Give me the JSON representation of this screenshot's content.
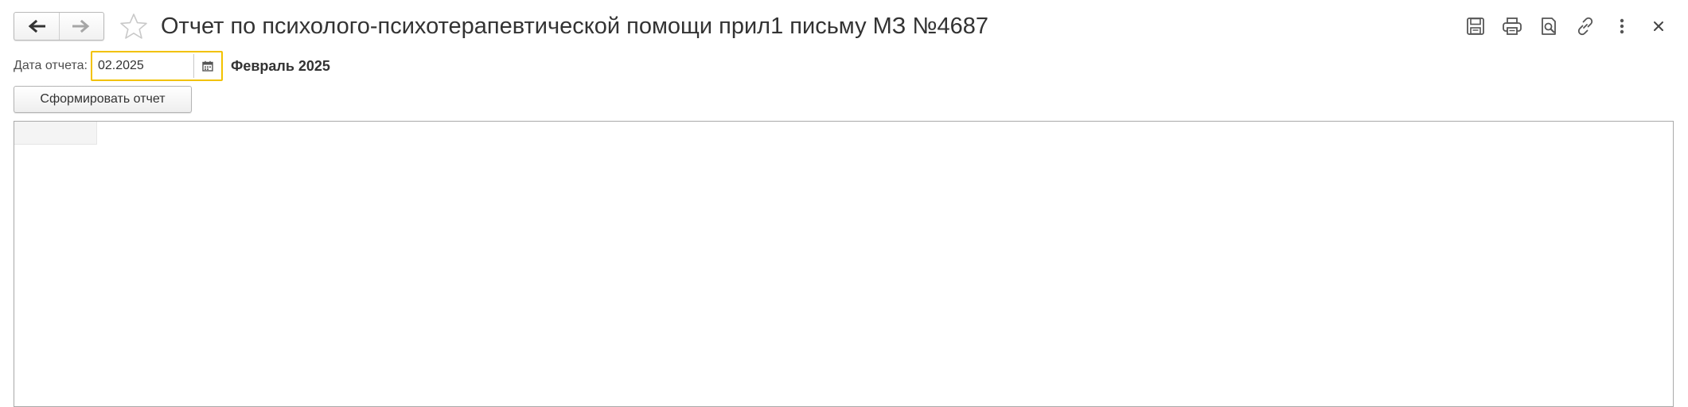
{
  "window": {
    "title": "Отчет по психолого-психотерапевтической помощи прил1 письму МЗ №4687"
  },
  "icons": {
    "back": "arrow-left-icon",
    "forward": "arrow-right-icon",
    "favorite": "star-icon",
    "save": "floppy-disk-icon",
    "print": "printer-icon",
    "preview": "page-preview-icon",
    "link": "link-icon",
    "more": "vertical-dots-icon",
    "close": "close-icon",
    "calendar": "calendar-icon"
  },
  "form": {
    "date_label": "Дата отчета:",
    "date_value": "02.2025",
    "period_text": "Февраль 2025",
    "generate_button": "Сформировать отчет"
  },
  "colors": {
    "focus_border": "#f2c200",
    "text": "#333333"
  }
}
